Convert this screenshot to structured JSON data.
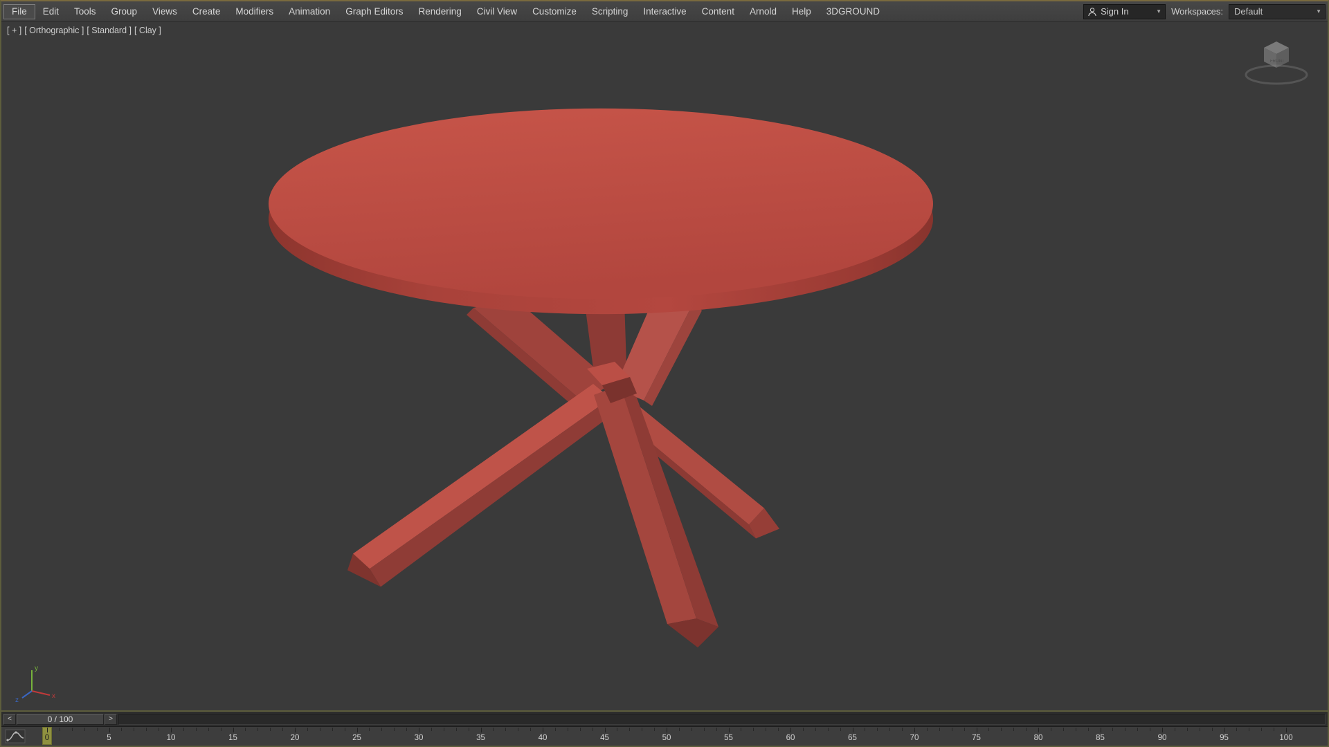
{
  "menubar": {
    "items": [
      "File",
      "Edit",
      "Tools",
      "Group",
      "Views",
      "Create",
      "Modifiers",
      "Animation",
      "Graph Editors",
      "Rendering",
      "Civil View",
      "Customize",
      "Scripting",
      "Interactive",
      "Content",
      "Arnold",
      "Help",
      "3DGROUND"
    ],
    "sign_in": {
      "label": "Sign In",
      "caret": "▼"
    },
    "workspaces": {
      "label": "Workspaces:",
      "value": "Default",
      "caret": "▼"
    }
  },
  "viewport": {
    "label_segments": [
      "[ + ]",
      "[ Orthographic ]",
      "[ Standard ]",
      "[ Clay ]"
    ],
    "viewcube_front_label": "FRONT",
    "axis_labels": {
      "x": "x",
      "y": "y",
      "z": "z"
    },
    "model": {
      "name": "round clay table",
      "clay_color": "#bf4e45"
    },
    "background_color": "#3a3a3a"
  },
  "timeline": {
    "prev_frame_button": "<",
    "next_frame_button": ">",
    "slider_value": "0 / 100",
    "ruler": {
      "start": 0,
      "end": 100,
      "label_step": 5,
      "current_frame": 0
    }
  },
  "colors": {
    "window_border": "#5d5d3c",
    "menubar_bg": "#424242",
    "frame_marker": "#8f9140"
  }
}
